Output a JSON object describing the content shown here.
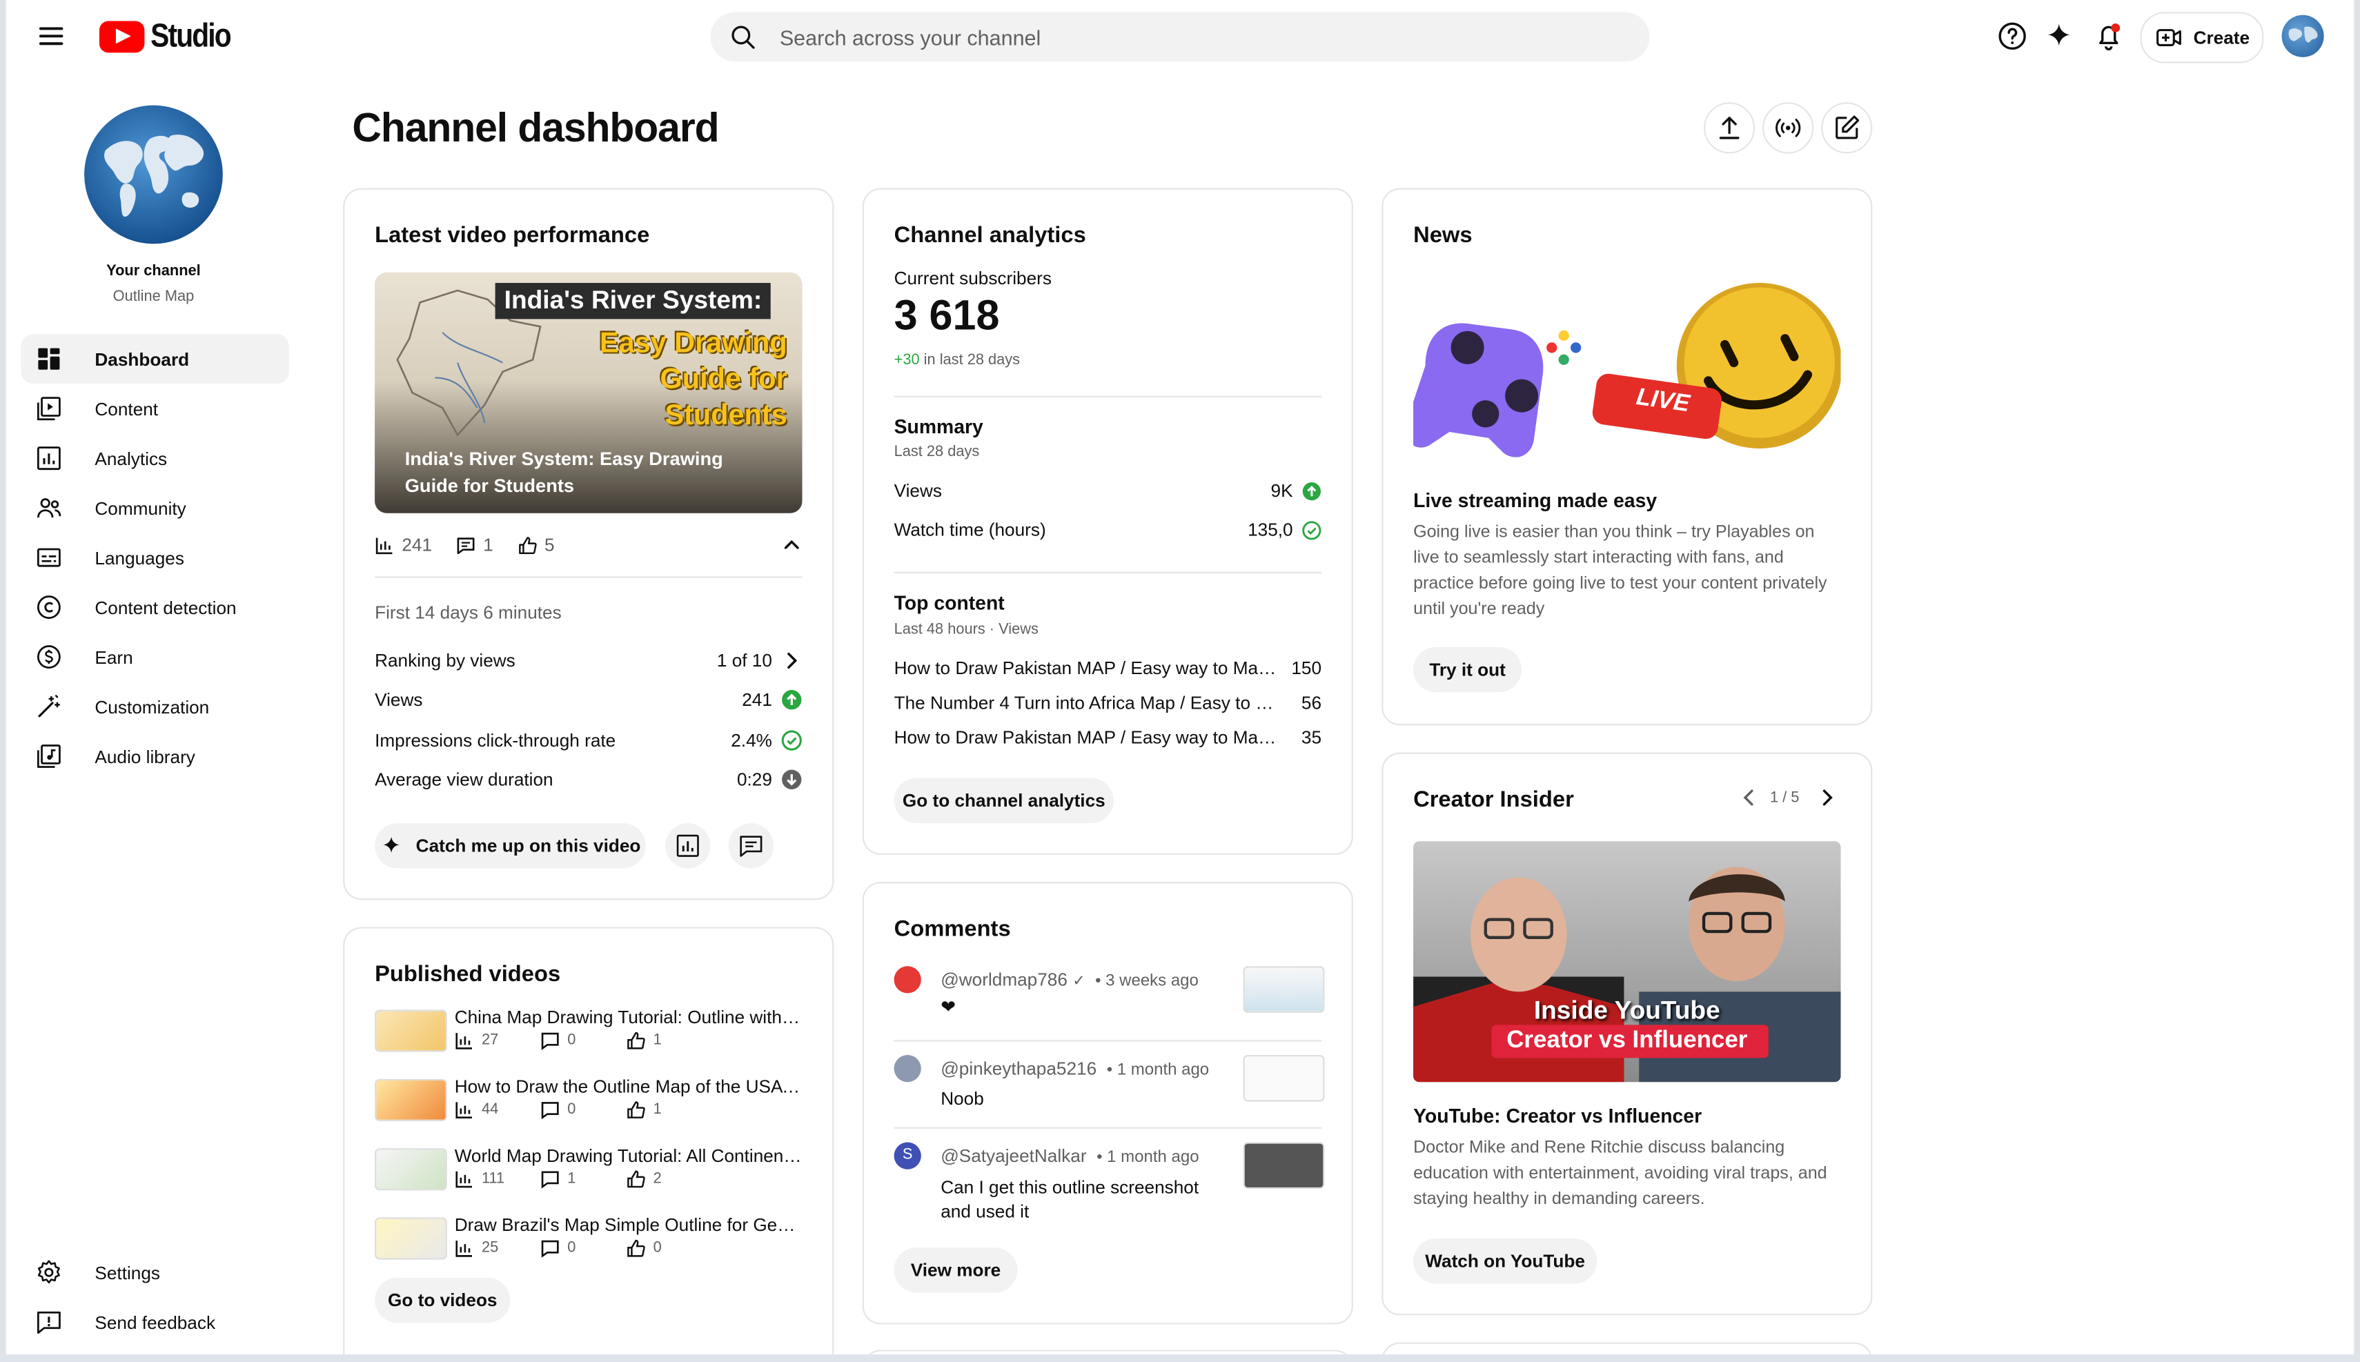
{
  "header": {
    "app_name": "Studio",
    "search_placeholder": "Search across your channel",
    "create_label": "Create"
  },
  "sidebar": {
    "channel_title": "Your channel",
    "channel_name": "Outline Map",
    "items": [
      {
        "label": "Dashboard",
        "icon": "dashboard-icon",
        "active": true
      },
      {
        "label": "Content",
        "icon": "content-icon"
      },
      {
        "label": "Analytics",
        "icon": "analytics-icon"
      },
      {
        "label": "Community",
        "icon": "community-icon"
      },
      {
        "label": "Languages",
        "icon": "languages-icon"
      },
      {
        "label": "Content detection",
        "icon": "content-detection-icon"
      },
      {
        "label": "Earn",
        "icon": "earn-icon"
      },
      {
        "label": "Customization",
        "icon": "customization-icon"
      },
      {
        "label": "Audio library",
        "icon": "audio-library-icon"
      }
    ],
    "bottom": [
      {
        "label": "Settings",
        "icon": "settings-icon"
      },
      {
        "label": "Send feedback",
        "icon": "feedback-icon"
      }
    ]
  },
  "page": {
    "title": "Channel dashboard"
  },
  "latest_video": {
    "title": "Latest video performance",
    "thumb_heading": "India's River System:",
    "thumb_sub": "Easy Drawing Guide for Students",
    "video_title": "India's River System: Easy Drawing Guide for Students",
    "views": "241",
    "comments": "1",
    "likes": "5",
    "period": "First 14 days 6 minutes",
    "metrics": [
      {
        "label": "Ranking by views",
        "value": "1 of 10",
        "indicator": "chevron"
      },
      {
        "label": "Views",
        "value": "241",
        "indicator": "up-green"
      },
      {
        "label": "Impressions click-through rate",
        "value": "2.4%",
        "indicator": "check-green"
      },
      {
        "label": "Average view duration",
        "value": "0:29",
        "indicator": "down-gray"
      }
    ],
    "catch_up_label": "Catch me up on this video"
  },
  "published": {
    "title": "Published videos",
    "videos": [
      {
        "title": "China Map Drawing Tutorial: Outline with Pr...",
        "views": "27",
        "comments": "0",
        "likes": "1"
      },
      {
        "title": "How to Draw the Outline Map of the USA wi...",
        "views": "44",
        "comments": "0",
        "likes": "1"
      },
      {
        "title": "World Map Drawing Tutorial: All Continents ...",
        "views": "111",
        "comments": "1",
        "likes": "2"
      },
      {
        "title": "Draw Brazil's Map Simple Outline for Geogr...",
        "views": "25",
        "comments": "0",
        "likes": "0"
      }
    ],
    "button": "Go to videos"
  },
  "analytics": {
    "title": "Channel analytics",
    "subs_label": "Current subscribers",
    "subs_value": "3 618",
    "subs_change": "+30",
    "subs_change_suffix": " in last 28 days",
    "summary_title": "Summary",
    "summary_period": "Last 28 days",
    "summary": [
      {
        "label": "Views",
        "value": "9K",
        "indicator": "up-green"
      },
      {
        "label": "Watch time (hours)",
        "value": "135,0",
        "indicator": "check-green"
      }
    ],
    "top_title": "Top content",
    "top_period": "Last 48 hours · Views",
    "top": [
      {
        "title": "How to Draw Pakistan MAP / Easy way to Make ...",
        "views": "150"
      },
      {
        "title": "The Number 4 Turn into Africa Map / Easy to dra...",
        "views": "56"
      },
      {
        "title": "How to Draw Pakistan MAP / Easy way to Make ...",
        "views": "35"
      }
    ],
    "button": "Go to channel analytics"
  },
  "comments": {
    "title": "Comments",
    "items": [
      {
        "handle": "@worldmap786",
        "time": "• 3 weeks ago",
        "text": "❤",
        "avatar_color": "#e53935"
      },
      {
        "handle": "@pinkeythapa5216",
        "time": "• 1 month ago",
        "text": "Noob",
        "avatar_color": "#8d99ae"
      },
      {
        "handle": "@SatyajeetNalkar",
        "time": "• 1 month ago",
        "text": "Can I get this outline screenshot and used it",
        "avatar_color": "#3f51b5",
        "initial": "S"
      }
    ],
    "button": "View more"
  },
  "news": {
    "title": "News",
    "live_badge": "LIVE",
    "heading": "Live streaming made easy",
    "body": "Going live is easier than you think – try Playables on live to seamlessly start interacting with fans, and practice before going live to test your content privately until you're ready",
    "button": "Try it out"
  },
  "creator_insider": {
    "title": "Creator Insider",
    "pager": "1 / 5",
    "thumb_line1": "Inside YouTube",
    "thumb_line2": "Creator vs Influencer",
    "heading": "YouTube: Creator vs Influencer",
    "body": "Doctor Mike and Rene Ritchie discuss balancing education with entertainment, avoiding viral traps, and staying healthy in demanding careers.",
    "button": "Watch on YouTube"
  },
  "colors": {
    "accent_red": "#ff0000",
    "green": "#2ba640",
    "text": "#0f0f0f",
    "muted": "#606060"
  }
}
